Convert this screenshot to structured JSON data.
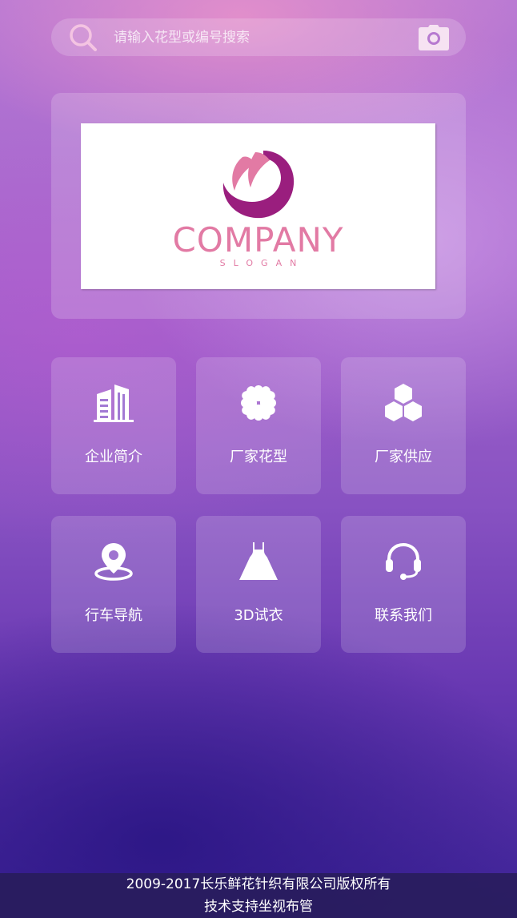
{
  "search": {
    "placeholder": "请输入花型或编号搜索",
    "value": ""
  },
  "banner": {
    "logo_text": "COMPANY",
    "slogan_text": "SLOGAN"
  },
  "menu": {
    "items": [
      {
        "label": "企业简介",
        "icon": "building-icon"
      },
      {
        "label": "厂家花型",
        "icon": "clover-icon"
      },
      {
        "label": "厂家供应",
        "icon": "hexagons-icon"
      },
      {
        "label": "行车导航",
        "icon": "location-pin-icon"
      },
      {
        "label": "3D试衣",
        "icon": "dress-icon"
      },
      {
        "label": "联系我们",
        "icon": "headset-icon"
      }
    ]
  },
  "footer": {
    "copyright": "2009-2017长乐鲜花针织有限公司版权所有",
    "support": "技术支持坐视布管"
  },
  "colors": {
    "logo_pink": "#e27aa4",
    "logo_purple": "#9a1e7e",
    "search_icon_color": "#f4b6d8"
  }
}
